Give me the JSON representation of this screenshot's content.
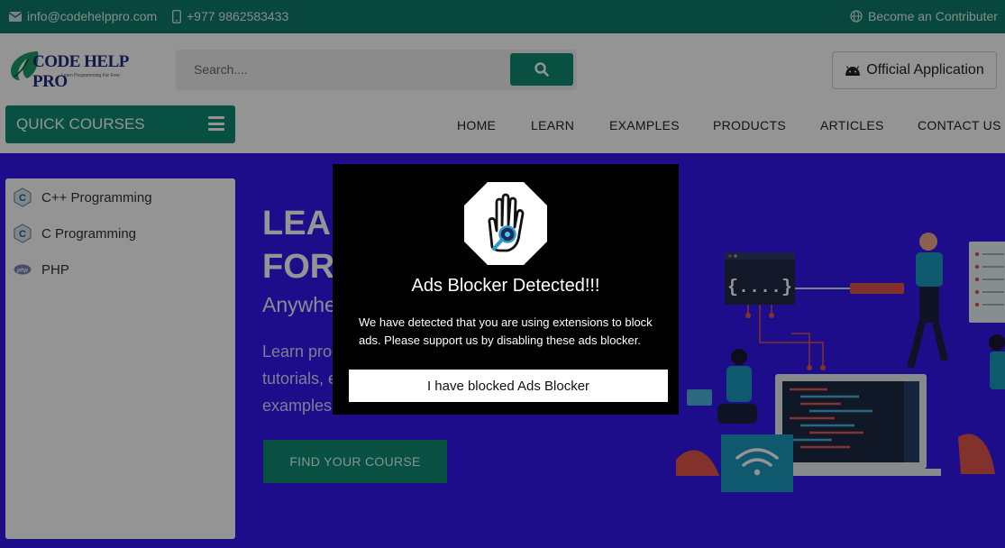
{
  "topbar": {
    "email": "info@codehelppro.com",
    "phone": "+977 9862583433",
    "contributor": "Become an Contributer"
  },
  "header": {
    "logo_text": "CODE HELP PRO",
    "logo_tagline": "Learn Programming For Free",
    "search_placeholder": "Search....",
    "official_app": "Official Application"
  },
  "nav": {
    "quick_courses": "QUICK COURSES",
    "items": [
      "HOME",
      "LEARN",
      "EXAMPLES",
      "PRODUCTS",
      "ARTICLES",
      "CONTACT US"
    ]
  },
  "sidebar": {
    "items": [
      {
        "label": "C++ Programming",
        "icon": "cpp-icon"
      },
      {
        "label": "C Programming",
        "icon": "c-icon"
      },
      {
        "label": "PHP",
        "icon": "php-icon"
      }
    ]
  },
  "hero": {
    "title_line1": "LEA",
    "title_line2": "FOR",
    "subtitle": "Anywhe",
    "desc_line1": "Learn prog",
    "desc_line2": "tutorials, e",
    "desc_line3": "examples",
    "cta": "FIND YOUR COURSE",
    "code_snippet": "{....}"
  },
  "modal": {
    "title": "Ads Blocker Detected!!!",
    "message": "We have detected that you are using extensions to block ads. Please support us by disabling these ads blocker.",
    "button": "I have blocked Ads Blocker"
  },
  "colors": {
    "brand": "#0f8a72",
    "topbar": "#0d7a69",
    "hero_bg": "#3318f0",
    "modal_bg": "#000000"
  }
}
